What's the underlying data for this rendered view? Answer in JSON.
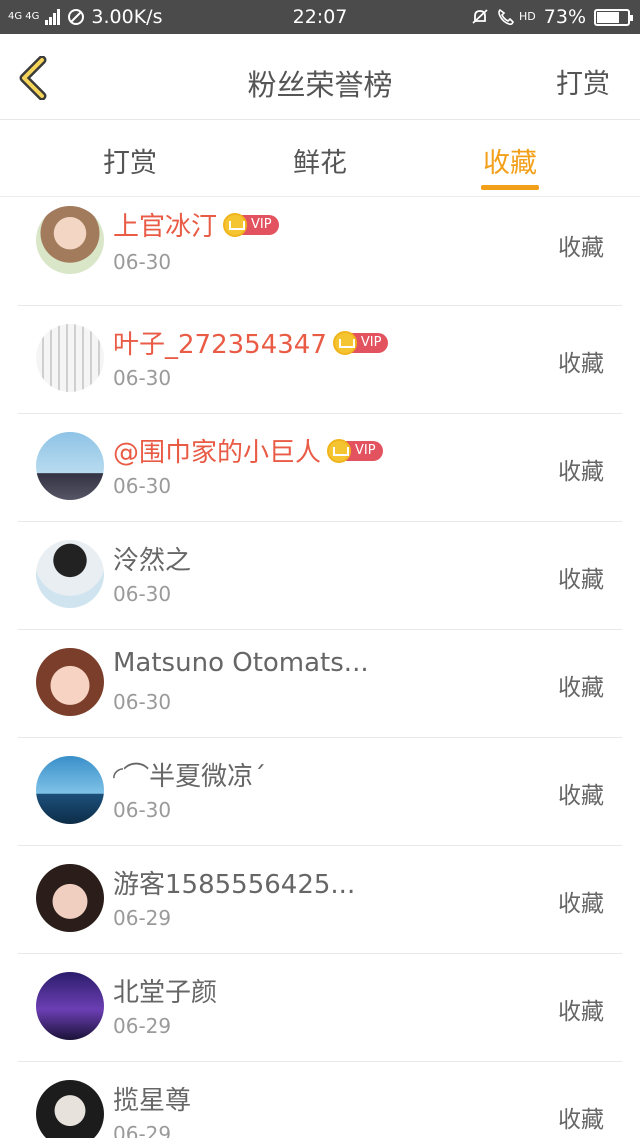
{
  "status_bar": {
    "network": "4G 4G",
    "speed": "3.00K/s",
    "time": "22:07",
    "hd": "HD",
    "battery": "73%",
    "battery_level": 0.73
  },
  "header": {
    "title": "粉丝荣誉榜",
    "action": "打赏"
  },
  "tabs": [
    {
      "label": "打赏",
      "active": false
    },
    {
      "label": "鲜花",
      "active": false
    },
    {
      "label": "收藏",
      "active": true
    }
  ],
  "colors": {
    "accent": "#f2a01a",
    "vip_name": "#e95b45",
    "vip_tag": "#e2525f",
    "crown": "#f5c531"
  },
  "list": [
    {
      "name": "上官冰汀",
      "date": "06-30",
      "vip": true,
      "vip_label": "VIP",
      "action": "收藏",
      "avatar": "avatar-anime-girl"
    },
    {
      "name": "叶子_272354347",
      "date": "06-30",
      "vip": true,
      "vip_label": "VIP",
      "action": "收藏",
      "avatar": "avatar-sketch"
    },
    {
      "name": "@围巾家的小巨人",
      "date": "06-30",
      "vip": true,
      "vip_label": "VIP",
      "action": "收藏",
      "avatar": "avatar-sky-silhouette"
    },
    {
      "name": "泠然之",
      "date": "06-30",
      "vip": false,
      "action": "收藏",
      "avatar": "avatar-hat-girl"
    },
    {
      "name": "Matsuno Otomats...",
      "date": "06-30",
      "vip": false,
      "action": "收藏",
      "avatar": "avatar-anime-face"
    },
    {
      "name": "◜⌒半夏微凉ˊ",
      "date": "06-30",
      "vip": false,
      "action": "收藏",
      "avatar": "avatar-sea-couple"
    },
    {
      "name": "游客1585556425...",
      "date": "06-29",
      "vip": false,
      "action": "收藏",
      "avatar": "avatar-girl-photo"
    },
    {
      "name": "北堂子颜",
      "date": "06-29",
      "vip": false,
      "action": "收藏",
      "avatar": "avatar-purple-night"
    },
    {
      "name": "揽星尊",
      "date": "06-29",
      "vip": false,
      "action": "收藏",
      "avatar": "avatar-costume-man"
    }
  ]
}
